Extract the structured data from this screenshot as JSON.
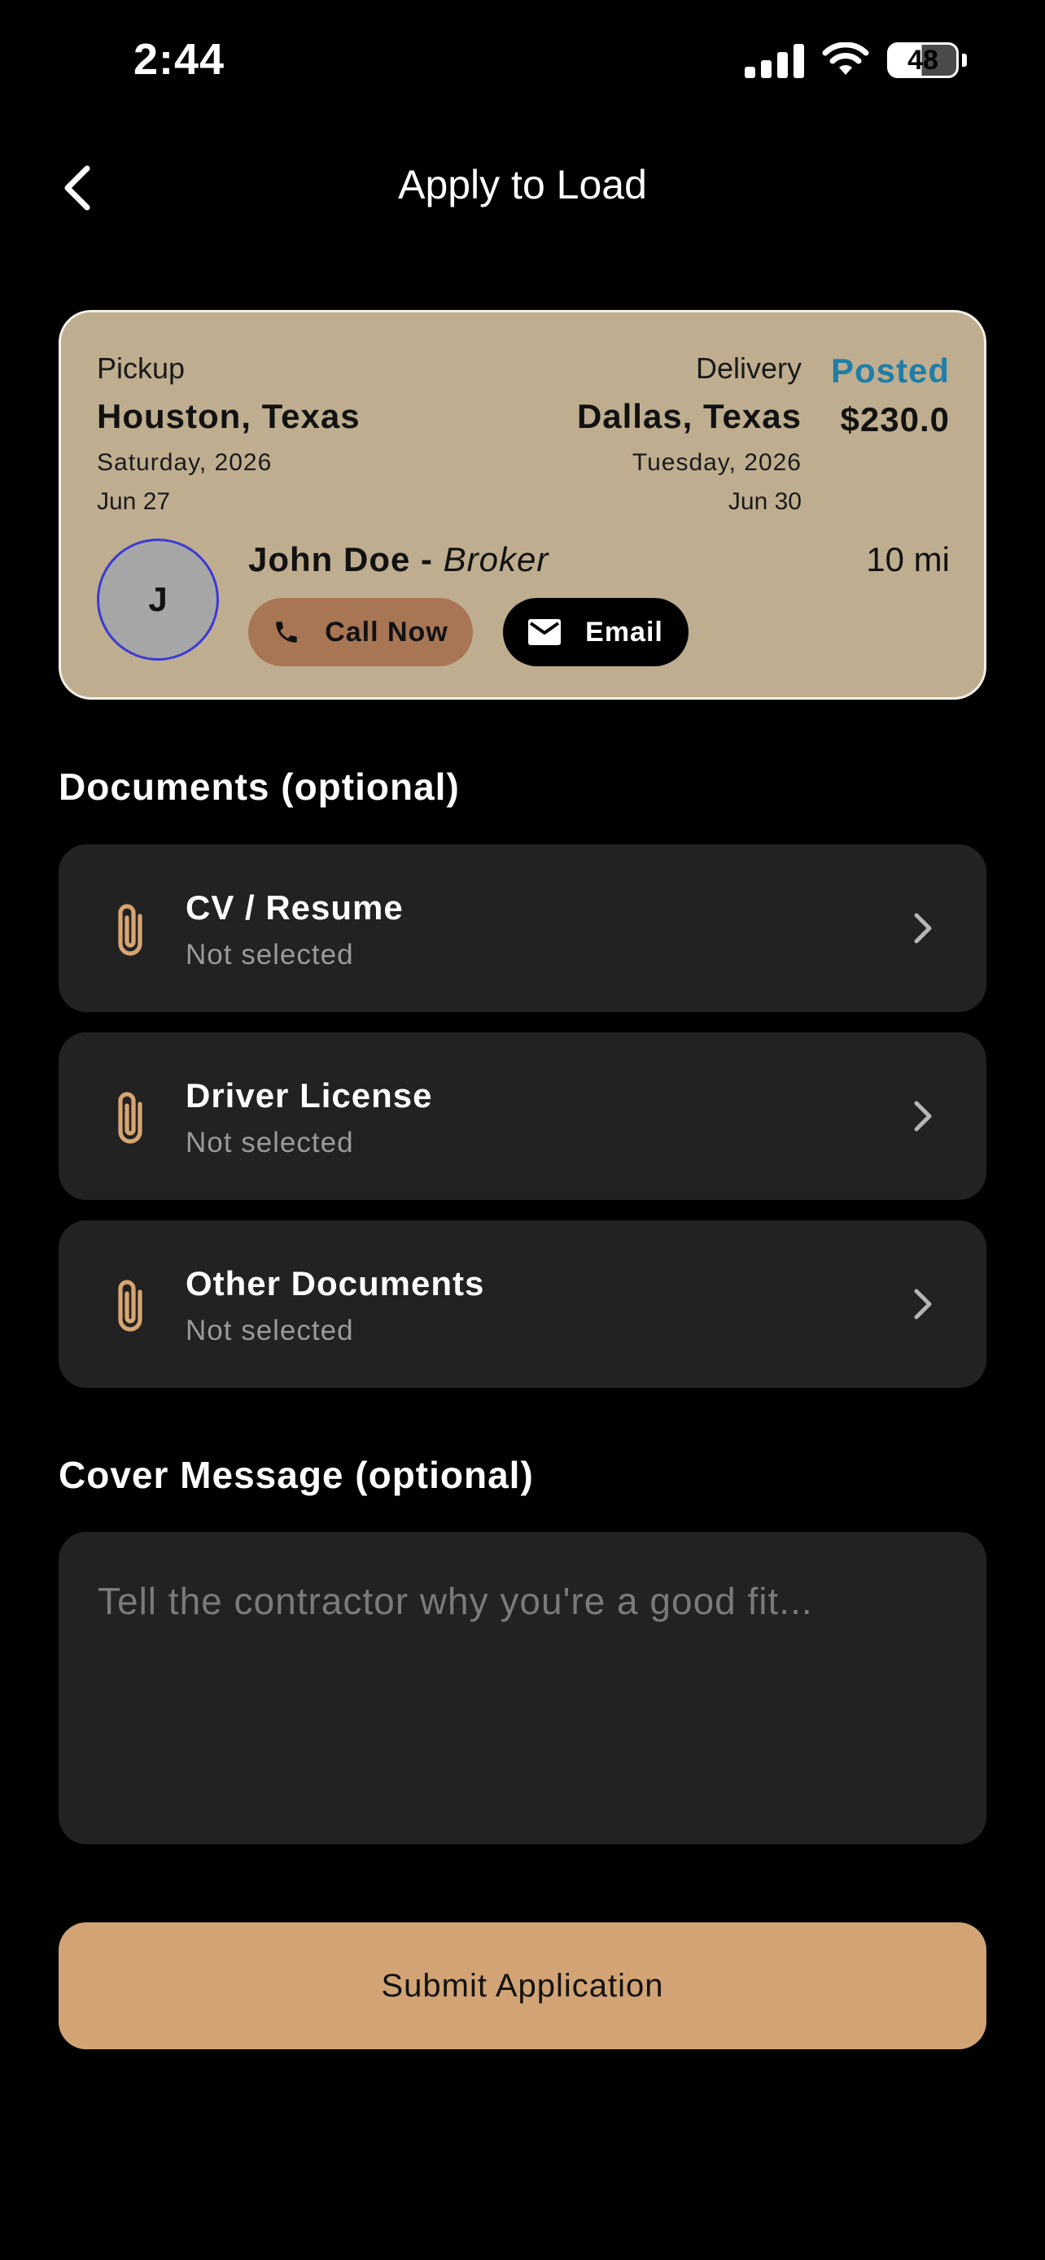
{
  "status_bar": {
    "time": "2:44",
    "battery": "48",
    "icons": [
      "signal-icon",
      "wifi-icon",
      "battery-icon"
    ]
  },
  "nav": {
    "back_icon": "chevron-left-icon",
    "title": "Apply to Load"
  },
  "load_card": {
    "pickup_label": "Pickup",
    "pickup_city": "Houston, Texas",
    "pickup_day": "Saturday, 2026",
    "pickup_date": "Jun 27",
    "delivery_label": "Delivery",
    "delivery_city": "Dallas, Texas",
    "delivery_day": "Tuesday, 2026",
    "delivery_date": "Jun 30",
    "status": "Posted",
    "price": "$230.0",
    "avatar_initial": "J",
    "broker_name": "John Doe - ",
    "broker_role": "Broker",
    "distance": "10 mi",
    "call_label": "Call Now",
    "email_label": "Email",
    "colors": {
      "card_bg": "#bfad8f",
      "status": "#1f7ea8",
      "call_btn": "#a87654",
      "avatar_border": "#3b3bd6"
    }
  },
  "documents": {
    "title": "Documents (optional)",
    "items": [
      {
        "title": "CV / Resume",
        "status": "Not selected",
        "icon": "paperclip-icon"
      },
      {
        "title": "Driver License",
        "status": "Not selected",
        "icon": "paperclip-icon"
      },
      {
        "title": "Other Documents",
        "status": "Not selected",
        "icon": "paperclip-icon"
      }
    ]
  },
  "cover": {
    "title": "Cover Message (optional)",
    "placeholder": "Tell the contractor why you're a good fit...",
    "value": ""
  },
  "submit": {
    "label": "Submit Application",
    "color": "#d2a475"
  }
}
